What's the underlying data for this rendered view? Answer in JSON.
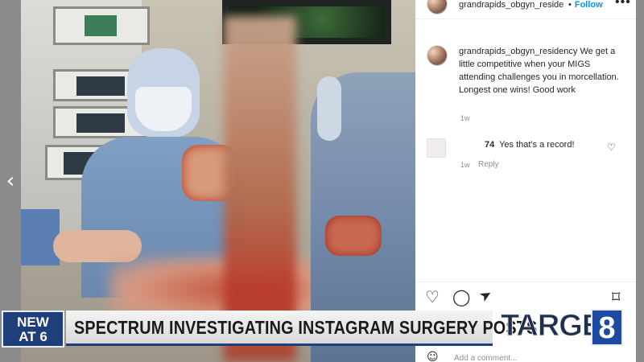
{
  "post": {
    "username": "grandrapids_obgyn_reside",
    "follow_label": "Follow",
    "more_label": "•••",
    "separator": "•",
    "caption_user": "grandrapids_obgyn_residency",
    "caption_text": "We get a little competitive when your MIGS attending challenges you in morcellation. Longest one wins! Good work",
    "caption_time": "1w",
    "comment_user": "74",
    "comment_text": "Yes that's a record!",
    "comment_time": "1w",
    "reply_label": "Reply",
    "add_comment_placeholder": "Add a comment..."
  },
  "icons": {
    "carousel_prev": "‹",
    "like": "♡",
    "comment": "◯",
    "share": "➤",
    "save": "⌑",
    "small_heart": "♡",
    "emoji": "☺"
  },
  "news": {
    "badge_line1": "NEW",
    "badge_line2": "AT 6",
    "headline": "SPECTRUM INVESTIGATING INSTAGRAM SURGERY POSTS",
    "logo_text": "TARGET",
    "logo_num": "8"
  },
  "colors": {
    "instagram_blue": "#0095f6",
    "news_navy": "#1e3f7a",
    "logo_blue": "#1b4aa0"
  }
}
